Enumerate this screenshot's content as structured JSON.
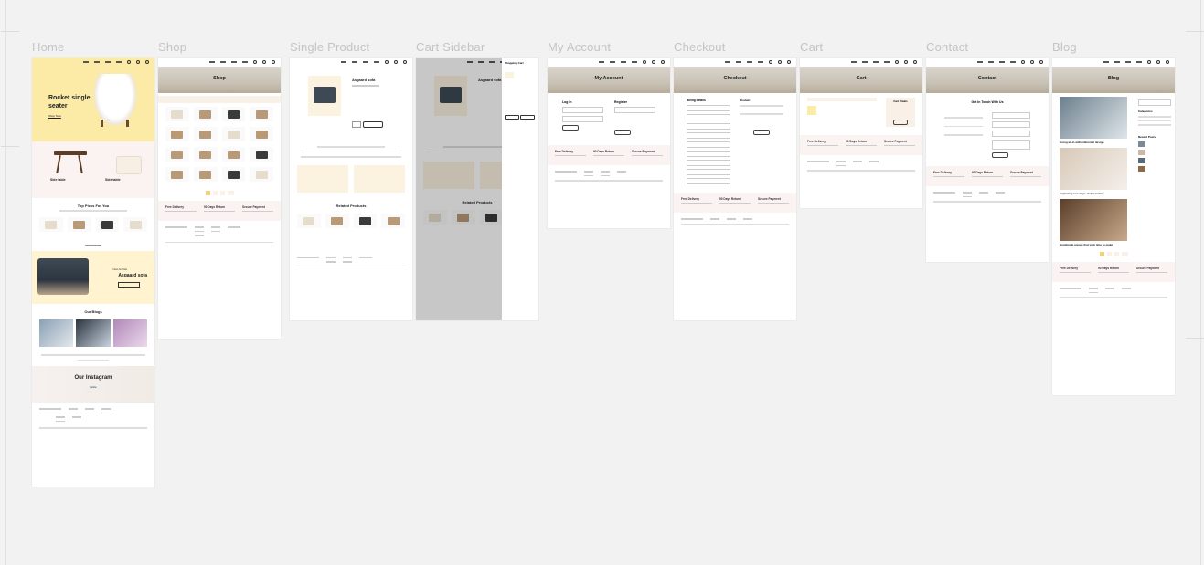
{
  "pages": [
    {
      "label": "Home"
    },
    {
      "label": "Shop"
    },
    {
      "label": "Single Product"
    },
    {
      "label": "Cart Sidebar"
    },
    {
      "label": "My Account"
    },
    {
      "label": "Checkout"
    },
    {
      "label": "Cart"
    },
    {
      "label": "Contact"
    },
    {
      "label": "Blog"
    }
  ],
  "home": {
    "hero_title_1": "Rocket single",
    "hero_title_2": "seater",
    "hero_link": "Shop Now",
    "side_table_1": "Side table",
    "side_table_2": "Side table",
    "top_picks": "Top Picks For You",
    "new_arrivals_tag": "New Arrivals",
    "asgaard": "Asgaard sofa",
    "our_blogs": "Our Blogs",
    "our_instagram": "Our Instagram",
    "follow": "Follow"
  },
  "shop": {
    "hero_title": "Shop"
  },
  "single": {
    "title": "Asgaard sofa",
    "related": "Related Products"
  },
  "cart_sidebar": {
    "title": "Asgaard sofa",
    "related": "Related Products",
    "sidebar_title": "Shopping Cart"
  },
  "account": {
    "hero_title": "My Account",
    "login": "Log In",
    "register": "Register"
  },
  "checkout": {
    "hero_title": "Checkout",
    "billing": "Billing details",
    "product": "Product"
  },
  "cart": {
    "hero_title": "Cart",
    "totals": "Cart Totals"
  },
  "contact": {
    "hero_title": "Contact",
    "get_in_touch": "Get In Touch With Us"
  },
  "blog": {
    "hero_title": "Blog",
    "categories": "Categories",
    "recent": "Recent Posts",
    "post_1": "Going all-in with millennial design",
    "post_2": "Exploring new ways of decorating",
    "post_3": "Handmade pieces that took time to make"
  },
  "features": {
    "free": "Free Delivery",
    "returns": "90 Days Return",
    "secure": "Secure Payment"
  }
}
